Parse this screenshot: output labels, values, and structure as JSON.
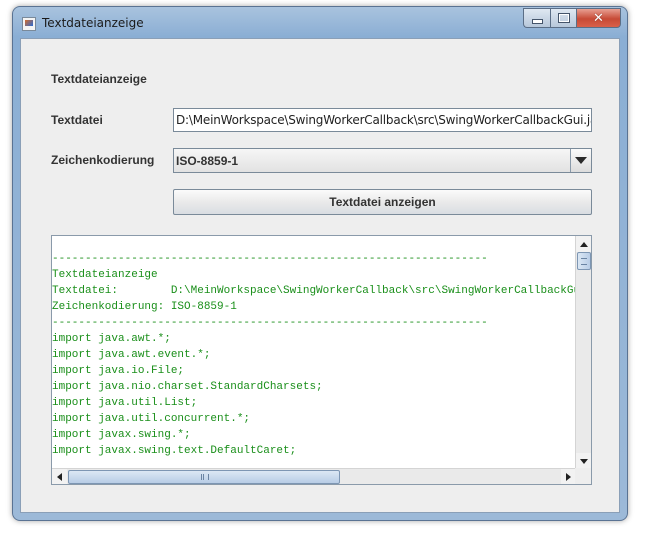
{
  "window": {
    "title": "Textdateianzeige"
  },
  "form": {
    "heading": "Textdateianzeige",
    "file_label": "Textdatei",
    "file_value": "D:\\MeinWorkspace\\SwingWorkerCallback\\src\\SwingWorkerCallbackGui.java",
    "encoding_label": "Zeichenkodierung",
    "encoding_value": "ISO-8859-1",
    "show_button": "Textdatei anzeigen"
  },
  "text_lines": [
    "",
    "------------------------------------------------------------------",
    "Textdateianzeige",
    "Textdatei:        D:\\MeinWorkspace\\SwingWorkerCallback\\src\\SwingWorkerCallbackGui.java",
    "Zeichenkodierung: ISO-8859-1",
    "------------------------------------------------------------------",
    "import java.awt.*;",
    "import java.awt.event.*;",
    "import java.io.File;",
    "import java.nio.charset.StandardCharsets;",
    "import java.util.List;",
    "import java.util.concurrent.*;",
    "import javax.swing.*;",
    "import javax.swing.text.DefaultCaret;"
  ],
  "colors": {
    "text_green": "#1a8f1a",
    "window_frame": "#8aaed4",
    "panel_bg": "#eeeeee"
  },
  "icons": {
    "app": "app-icon",
    "minimize": "minimize-icon",
    "maximize": "maximize-icon",
    "close": "close-icon",
    "combo": "chevron-down-icon"
  }
}
